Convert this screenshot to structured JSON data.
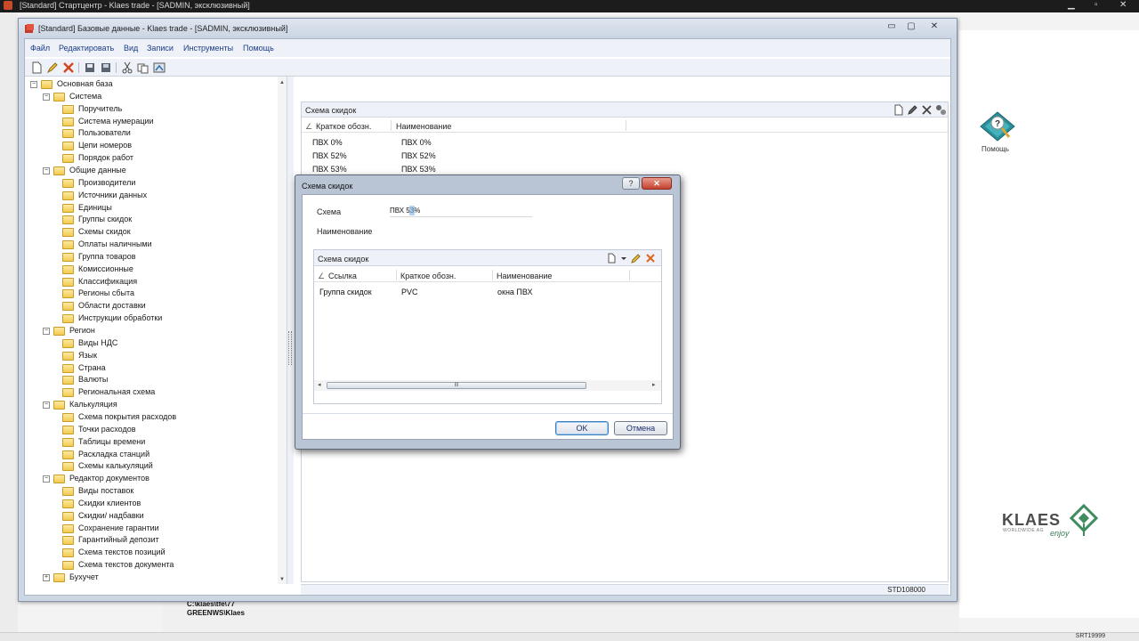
{
  "background_app": {
    "title": "[Standard] Стартцентр - Klaes trade - [SADMIN, эксклюзивный]",
    "help_label": "Помощь",
    "logo_text": "KLAES",
    "logo_tagline": "enjoy",
    "logo_sub": "WORLDWIDE AG",
    "path_line1": "C:\\klaes\\tfe\\77",
    "path_line2": "GREENWS\\Klaes",
    "status_code": "SRT19999"
  },
  "window": {
    "title": "[Standard] Базовые данные - Klaes trade - [SADMIN, эксклюзивный]",
    "controls": {
      "minimize": "▭",
      "maximize": "▢",
      "close": "✕"
    }
  },
  "menu": [
    "Файл",
    "Редактировать",
    "Вид",
    "Записи",
    "Инструменты",
    "Помощь"
  ],
  "toolbar_icons": [
    "new-icon",
    "edit-icon",
    "delete-icon",
    "save-icon",
    "save-all-icon",
    "cut-icon",
    "copy-icon",
    "import-icon"
  ],
  "tree": [
    {
      "label": "Основная база",
      "level": 0,
      "expander": "−"
    },
    {
      "label": "Система",
      "level": 1,
      "expander": "−"
    },
    {
      "label": "Поручитель",
      "level": 2
    },
    {
      "label": "Система нумерации",
      "level": 2
    },
    {
      "label": "Пользователи",
      "level": 2
    },
    {
      "label": "Цепи номеров",
      "level": 2
    },
    {
      "label": "Порядок работ",
      "level": 2
    },
    {
      "label": "Общие данные",
      "level": 1,
      "expander": "−"
    },
    {
      "label": "Производители",
      "level": 2
    },
    {
      "label": "Источники данных",
      "level": 2
    },
    {
      "label": "Единицы",
      "level": 2
    },
    {
      "label": "Группы скидок",
      "level": 2
    },
    {
      "label": "Схемы скидок",
      "level": 2
    },
    {
      "label": "Оплаты наличными",
      "level": 2
    },
    {
      "label": "Группа товаров",
      "level": 2
    },
    {
      "label": "Комиссионные",
      "level": 2
    },
    {
      "label": "Классификация",
      "level": 2
    },
    {
      "label": "Регионы сбыта",
      "level": 2
    },
    {
      "label": "Области доставки",
      "level": 2
    },
    {
      "label": "Инструкции обработки",
      "level": 2
    },
    {
      "label": "Регион",
      "level": 1,
      "expander": "−"
    },
    {
      "label": "Виды НДС",
      "level": 2
    },
    {
      "label": "Язык",
      "level": 2
    },
    {
      "label": "Страна",
      "level": 2
    },
    {
      "label": "Валюты",
      "level": 2
    },
    {
      "label": "Региональная схема",
      "level": 2
    },
    {
      "label": "Калькуляция",
      "level": 1,
      "expander": "−"
    },
    {
      "label": "Схема покрытия расходов",
      "level": 2
    },
    {
      "label": "Точки расходов",
      "level": 2
    },
    {
      "label": "Таблицы времени",
      "level": 2
    },
    {
      "label": "Раскладка станций",
      "level": 2
    },
    {
      "label": "Схемы калькуляций",
      "level": 2
    },
    {
      "label": "Редактор документов",
      "level": 1,
      "expander": "−"
    },
    {
      "label": "Виды поставок",
      "level": 2
    },
    {
      "label": "Скидки клиентов",
      "level": 2
    },
    {
      "label": "Скидки/ надбавки",
      "level": 2
    },
    {
      "label": "Сохранение гарантии",
      "level": 2
    },
    {
      "label": "Гарантийный депозит",
      "level": 2
    },
    {
      "label": "Схема текстов позиций",
      "level": 2
    },
    {
      "label": "Схема текстов документа",
      "level": 2
    },
    {
      "label": "Бухучет",
      "level": 1,
      "expander": "+"
    }
  ],
  "panel": {
    "title": "Схема скидок",
    "columns": [
      "Краткое обозн.",
      "Наименование"
    ],
    "sort_marker": "∠",
    "rows": [
      [
        "ПВХ 0%",
        "ПВХ 0%"
      ],
      [
        "ПВХ 52%",
        "ПВХ 52%"
      ],
      [
        "ПВХ 53%",
        "ПВХ 53%"
      ]
    ]
  },
  "status_code": "STD108000",
  "dialog": {
    "title": "Схема скидок",
    "help_button": "?",
    "close_button": "✕",
    "field_schema_label": "Схема",
    "field_schema_value": "ПВХ 53%",
    "field_name_label": "Наименование",
    "sub_title": "Схема скидок",
    "sub_columns": [
      "Ссылка",
      "Краткое обозн.",
      "Наименование"
    ],
    "sub_rows": [
      [
        "Группа скидок",
        "PVC",
        "окна ПВХ"
      ]
    ],
    "scroll_thumb": "III",
    "ok_label": "OK",
    "cancel_label": "Отмена"
  }
}
